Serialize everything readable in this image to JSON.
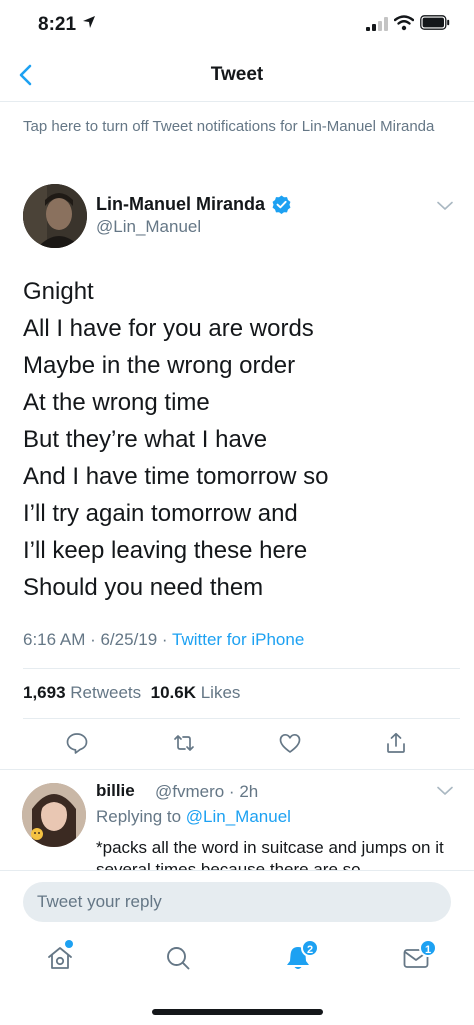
{
  "status_bar": {
    "time": "8:21"
  },
  "nav": {
    "title": "Tweet"
  },
  "notification_hint": "Tap here to turn off Tweet notifications for Lin-Manuel Miranda",
  "tweet": {
    "author_name": "Lin-Manuel Miranda",
    "author_handle": "@Lin_Manuel",
    "lines": [
      "Gnight",
      "All I have for you are words",
      "Maybe in the wrong order",
      "At the wrong time",
      "But they’re what I have",
      "And I have time tomorrow so",
      "I’ll try again tomorrow and",
      "I’ll keep leaving these here",
      "Should you need them"
    ],
    "timestamp": "6:16 AM · 6/25/19 · ",
    "source": "Twitter for iPhone",
    "retweets_count": "1,693",
    "retweets_label": "Retweets",
    "likes_count": "10.6K",
    "likes_label": "Likes"
  },
  "reply": {
    "name": "billie",
    "handle": "@fvmero · 2h",
    "replying_prefix": "Replying to ",
    "replying_to": "@Lin_Manuel",
    "text": "*packs all the word in suitcase and jumps on it several times because there are so"
  },
  "composer": {
    "placeholder": "Tweet your reply"
  },
  "tabbar": {
    "notifications_badge": "2",
    "messages_badge": "1"
  },
  "colors": {
    "accent": "#1da1f2",
    "secondary_text": "#657786",
    "divider": "#e6ecf0"
  }
}
